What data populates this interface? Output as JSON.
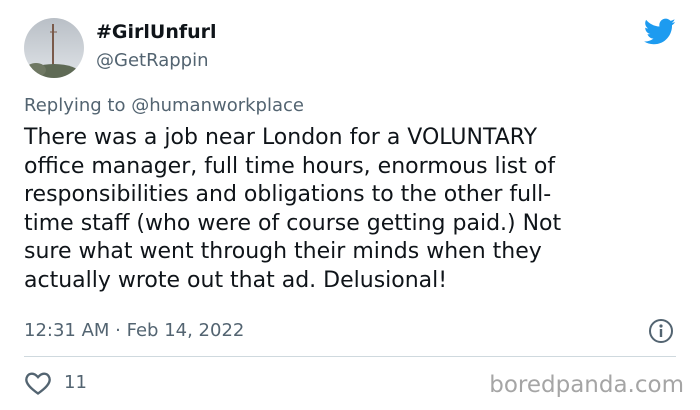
{
  "author": {
    "display_name": "#GirlUnfurl",
    "handle": "@GetRappin"
  },
  "reply": {
    "prefix": "Replying to ",
    "mention": "@humanworkplace"
  },
  "tweet": {
    "text": "There was a job near London for a VOLUNTARY\noffice manager, full time hours, enormous list of\nresponsibilities and obligations to the other full-\ntime staff (who were of course getting paid.) Not\nsure what went through their minds when they\nactually wrote out that ad. Delusional!",
    "timestamp": "12:31 AM · Feb 14, 2022",
    "like_count": "11"
  },
  "icons": {
    "brand": "twitter-bird-icon",
    "info": "info-icon",
    "like": "heart-icon",
    "colors": {
      "twitter_blue": "#1d9bf0",
      "muted": "#536471"
    }
  },
  "watermark": "boredpanda.com"
}
